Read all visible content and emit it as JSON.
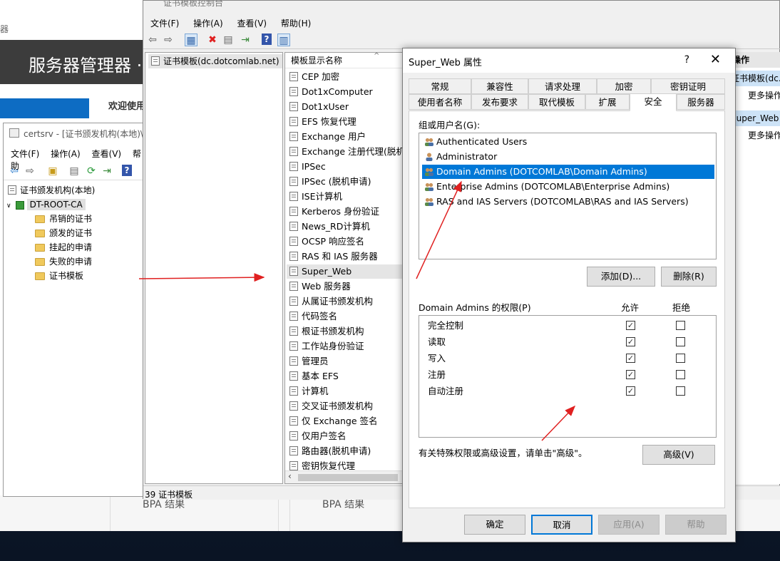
{
  "server_manager": {
    "title_fragment": "器",
    "header": "服务器管理器 ·",
    "welcome": "欢迎使用",
    "bpa_1": "BPA 结果",
    "bpa_2": "BPA 结果"
  },
  "certsrv": {
    "title": "certsrv - [证书颁发机构(本地)\\",
    "menu": [
      "文件(F)",
      "操作(A)",
      "查看(V)",
      "帮助"
    ],
    "tree_root": "证书颁发机构(本地)",
    "ca_name": "DT-ROOT-CA",
    "folders": [
      "吊销的证书",
      "颁发的证书",
      "挂起的申请",
      "失败的申请",
      "证书模板"
    ]
  },
  "mmc": {
    "title": "证书模板控制台",
    "menu": [
      "文件(F)",
      "操作(A)",
      "查看(V)",
      "帮助(H)"
    ],
    "tree_item": "证书模板(dc.dotcomlab.net)",
    "column_header": "模板显示名称",
    "templates": [
      "CEP 加密",
      "Dot1xComputer",
      "Dot1xUser",
      "EFS 恢复代理",
      "Exchange 用户",
      "Exchange 注册代理(脱机申",
      "IPSec",
      "IPSec (脱机申请)",
      "ISE计算机",
      "Kerberos 身份验证",
      "News_RD计算机",
      "OCSP 响应签名",
      "RAS 和 IAS 服务器",
      "Super_Web",
      "Web 服务器",
      "从属证书颁发机构",
      "代码签名",
      "根证书颁发机构",
      "工作站身份验证",
      "管理员",
      "基本 EFS",
      "计算机",
      "交叉证书颁发机构",
      "仅 Exchange 签名",
      "仅用户签名",
      "路由器(脱机申请)",
      "密钥恢复代理"
    ],
    "selected_template": "Super_Web",
    "status": "39 证书模板",
    "actions_header": "操作",
    "actions_sel_1": "证书模板(dc.",
    "actions_link_1": "更多操作",
    "actions_sel_2": "Super_Web",
    "actions_link_2": "更多操作"
  },
  "dialog": {
    "title": "Super_Web 属性",
    "help": "?",
    "close": "✕",
    "tabs_row1": [
      "常规",
      "兼容性",
      "请求处理",
      "加密",
      "密钥证明"
    ],
    "tabs_row2": [
      "使用者名称",
      "发布要求",
      "取代模板",
      "扩展",
      "安全",
      "服务器"
    ],
    "active_tab": "安全",
    "group_label": "组或用户名(G):",
    "users": [
      "Authenticated Users",
      "Administrator",
      "Domain Admins (DOTCOMLAB\\Domain Admins)",
      "Enterprise Admins (DOTCOMLAB\\Enterprise Admins)",
      "RAS and IAS Servers (DOTCOMLAB\\RAS and IAS Servers)"
    ],
    "selected_user": "Domain Admins (DOTCOMLAB\\Domain Admins)",
    "add_button": "添加(D)...",
    "remove_button": "删除(R)",
    "perm_label": "Domain Admins 的权限(P)",
    "allow_header": "允许",
    "deny_header": "拒绝",
    "permissions": [
      {
        "name": "完全控制",
        "allow": true,
        "deny": false
      },
      {
        "name": "读取",
        "allow": true,
        "deny": false
      },
      {
        "name": "写入",
        "allow": true,
        "deny": false
      },
      {
        "name": "注册",
        "allow": true,
        "deny": false
      },
      {
        "name": "自动注册",
        "allow": true,
        "deny": false
      }
    ],
    "advanced_hint": "有关特殊权限或高级设置，请单击\"高级\"。",
    "advanced_button": "高级(V)",
    "ok": "确定",
    "cancel": "取消",
    "apply": "应用(A)",
    "help_button": "帮助"
  },
  "colors": {
    "selection": "#0078d7",
    "annotation_arrow": "#e02020"
  }
}
